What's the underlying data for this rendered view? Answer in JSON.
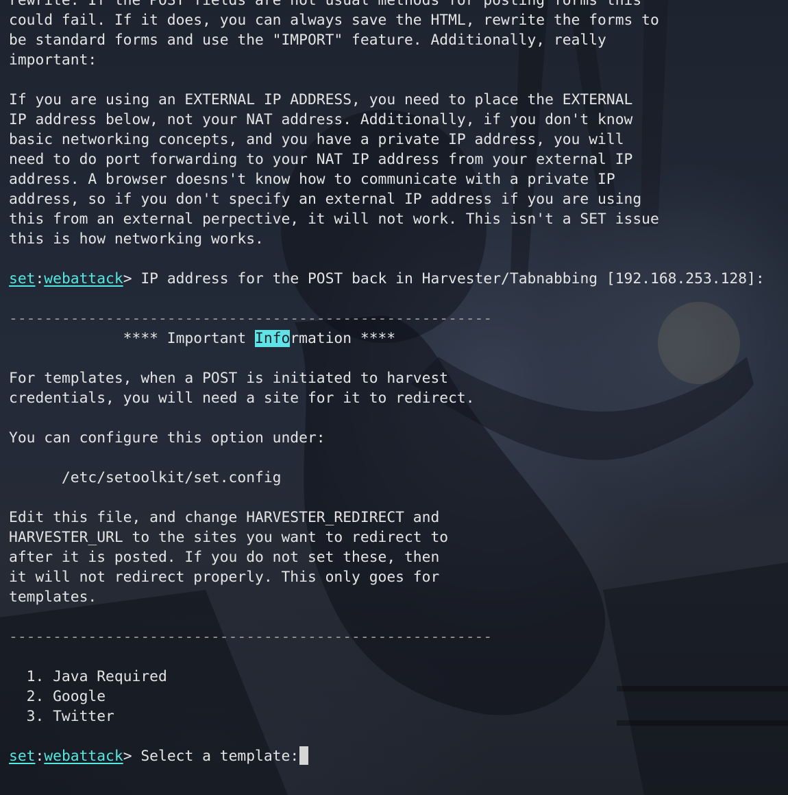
{
  "window": {
    "accent_color": "#54e8e0",
    "text_color": "#e4e4e4",
    "cursor_icon": "block-cursor"
  },
  "intro": {
    "lines": [
      "rewrite. If the POST fields are not usual methods for posting forms this",
      "could fail. If it does, you can always save the HTML, rewrite the forms to",
      "be standard forms and use the \"IMPORT\" feature. Additionally, really",
      "important:",
      "",
      "If you are using an EXTERNAL IP ADDRESS, you need to place the EXTERNAL",
      "IP address below, not your NAT address. Additionally, if you don't know",
      "basic networking concepts, and you have a private IP address, you will",
      "need to do port forwarding to your NAT IP address from your external IP",
      "address. A browser doesns't know how to communicate with a private IP",
      "address, so if you don't specify an external IP address if you are using",
      "this from an external perpective, it will not work. This isn't a SET issue",
      "this is how networking works."
    ]
  },
  "prompt1": {
    "set": "set",
    "colon": ":",
    "module": "webattack",
    "gt": ">",
    "text": " IP address for the POST back in Harvester/Tabnabbing [192.168.253.128]:"
  },
  "divider": "-------------------------------------------------------",
  "important": {
    "prefix": "             **** Important ",
    "highlight": "Info",
    "suffix": "rmation ****"
  },
  "info": {
    "lines": [
      "For templates, when a POST is initiated to harvest",
      "credentials, you will need a site for it to redirect.",
      "",
      "You can configure this option under:",
      "",
      "      /etc/setoolkit/set.config",
      "",
      "Edit this file, and change HARVESTER_REDIRECT and",
      "HARVESTER_URL to the sites you want to redirect to",
      "after it is posted. If you do not set these, then",
      "it will not redirect properly. This only goes for",
      "templates."
    ]
  },
  "templates": {
    "items": [
      "  1. Java Required",
      "  2. Google",
      "  3. Twitter"
    ]
  },
  "prompt2": {
    "set": "set",
    "colon": ":",
    "module": "webattack",
    "gt": ">",
    "text": " Select a template:"
  }
}
